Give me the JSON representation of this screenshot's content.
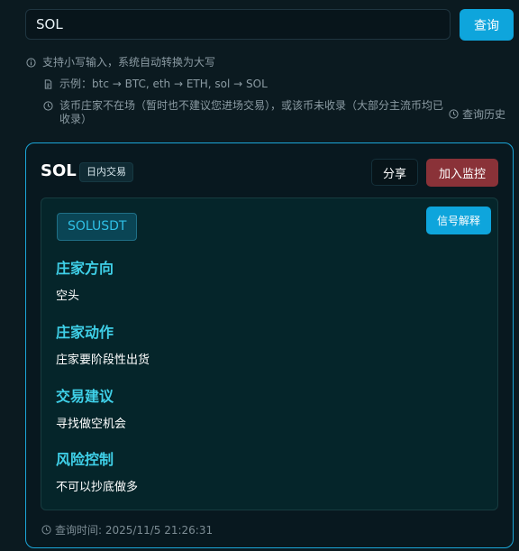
{
  "search": {
    "value": "SOL",
    "button_label": "查询"
  },
  "hints": {
    "line1": "支持小写输入，系统自动转换为大写",
    "line2": "示例：btc → BTC, eth → ETH, sol → SOL",
    "line3": "该币庄家不在场（暂时也不建议您进场交易），或该币未收录（大部分主流币均已收录）",
    "history_label": "查询历史"
  },
  "card": {
    "title": "SOL",
    "tag": "日内交易",
    "share_label": "分享",
    "monitor_label": "加入监控",
    "symbol": "SOLUSDT",
    "explain_label": "信号解释",
    "sections": [
      {
        "heading": "庄家方向",
        "body": "空头"
      },
      {
        "heading": "庄家动作",
        "body": "庄家要阶段性出货"
      },
      {
        "heading": "交易建议",
        "body": "寻找做空机会"
      },
      {
        "heading": "风险控制",
        "body": "不可以抄底做多"
      }
    ],
    "query_time": "查询时间: 2025/11/5 21:26:31"
  },
  "colors": {
    "accent": "#0ea5dc",
    "danger": "#8a3238",
    "section_heading": "#3fd0e8",
    "background": "#0b1a20"
  }
}
